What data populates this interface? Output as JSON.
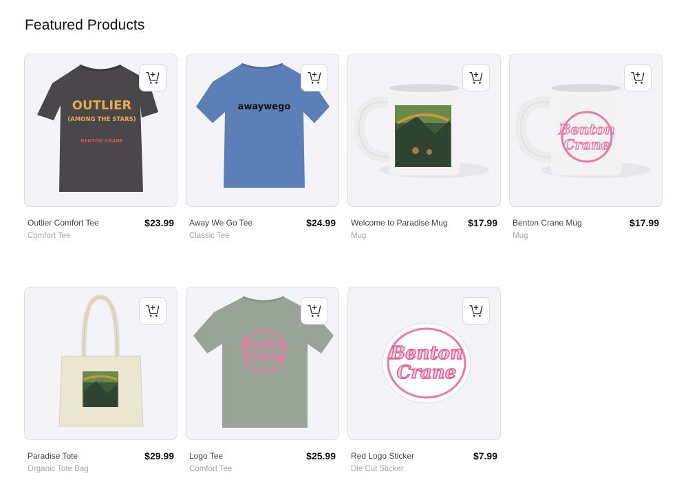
{
  "section": {
    "title": "Featured Products"
  },
  "products": [
    {
      "name": "Outlier Comfort Tee",
      "type": "Comfort Tee",
      "price": "$23.99",
      "art_lines": [
        "OUTLIER",
        "(AMONG THE STARS)",
        "BENTON CRANE"
      ],
      "color": "#4a474a"
    },
    {
      "name": "Away We Go Tee",
      "type": "Classic Tee",
      "price": "$24.99",
      "art_lines": [
        "awaywego"
      ],
      "color": "#5b7fb6"
    },
    {
      "name": "Welcome to Paradise Mug",
      "type": "Mug",
      "price": "$17.99",
      "color": "#f5f5f5"
    },
    {
      "name": "Benton Crane Mug",
      "type": "Mug",
      "price": "$17.99",
      "art_lines": [
        "Benton",
        "Crane"
      ],
      "color": "#f5f5f5"
    },
    {
      "name": "Paradise Tote",
      "type": "Organic Tote Bag",
      "price": "$29.99",
      "color": "#ece5cf"
    },
    {
      "name": "Logo Tee",
      "type": "Comfort Tee",
      "price": "$25.99",
      "art_lines": [
        "Benton",
        "Crane"
      ],
      "color": "#98a596"
    },
    {
      "name": "Red Logo Sticker",
      "type": "Die Cut Sticker",
      "price": "$7.99",
      "art_lines": [
        "Benton",
        "Crane"
      ],
      "color": "#e879a6"
    }
  ],
  "icons": {
    "add_to_cart": "cart-plus-icon"
  }
}
